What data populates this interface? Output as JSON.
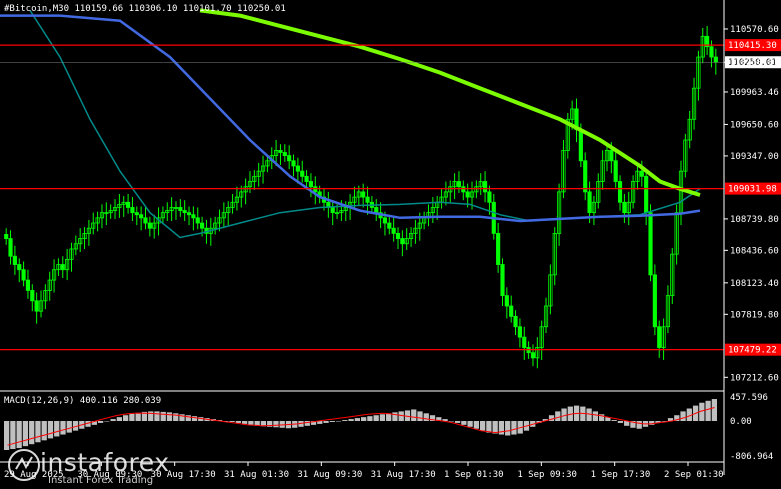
{
  "header": {
    "symbol": "#Bitcoin,M30",
    "ohlc": "110159.66 110306.10 110101.70 110250.01"
  },
  "price_axis": {
    "labels": [
      "110570.60",
      "110250.01",
      "109963.46",
      "109650.60",
      "109347.00",
      "108739.80",
      "108436.60",
      "108123.40",
      "107819.80",
      "107212.60"
    ],
    "highlighted": [
      {
        "label": "110415.30",
        "value": 110415.3,
        "color": "#ff0000"
      },
      {
        "label": "109031.98",
        "value": 109031.98,
        "color": "#ff0000"
      },
      {
        "label": "107479.22",
        "value": 107479.22,
        "color": "#ff0000"
      }
    ],
    "current": {
      "label": "110250.01",
      "value": 110250.01
    }
  },
  "time_axis": {
    "labels": [
      "29 Aug 2025",
      "30 Aug 09:30",
      "30 Aug 17:30",
      "31 Aug 01:30",
      "31 Aug 09:30",
      "31 Aug 17:30",
      "1 Sep 01:30",
      "1 Sep 09:30",
      "1 Sep 17:30",
      "2 Sep 01:30"
    ]
  },
  "macd": {
    "label": "MACD(12,26,9) 400.116 280.039",
    "axis_labels": [
      "457.596",
      "0.00",
      "-806.964"
    ]
  },
  "watermark": {
    "brand": "instaforex",
    "tagline": "Instant Forex Trading"
  },
  "colors": {
    "candle": "#00ff00",
    "ma_fast": "#4169e1",
    "ma_slow": "#7cfc00",
    "ma_teal": "#008b8b",
    "level": "#ff0000",
    "macd_hist": "#c0c0c0",
    "macd_signal": "#ff0000"
  },
  "chart_data": {
    "type": "candlestick",
    "ylim": [
      107100,
      110850
    ],
    "candles_close": [
      108550,
      108380,
      108300,
      108250,
      108150,
      108050,
      107950,
      107850,
      107950,
      108050,
      108150,
      108250,
      108300,
      108250,
      108350,
      108450,
      108500,
      108550,
      108600,
      108650,
      108700,
      108750,
      108800,
      108800,
      108820,
      108850,
      108880,
      108900,
      108850,
      108800,
      108780,
      108750,
      108700,
      108650,
      108700,
      108750,
      108800,
      108820,
      108850,
      108850,
      108820,
      108800,
      108780,
      108750,
      108700,
      108650,
      108600,
      108650,
      108700,
      108750,
      108800,
      108850,
      108900,
      108950,
      109000,
      109050,
      109100,
      109150,
      109200,
      109250,
      109300,
      109350,
      109400,
      109380,
      109350,
      109300,
      109250,
      109200,
      109150,
      109100,
      109050,
      109000,
      108950,
      108900,
      108850,
      108800,
      108800,
      108820,
      108850,
      108900,
      108950,
      109000,
      108950,
      108900,
      108850,
      108800,
      108750,
      108700,
      108650,
      108600,
      108550,
      108500,
      108550,
      108600,
      108650,
      108700,
      108750,
      108800,
      108850,
      108900,
      108950,
      109000,
      109050,
      109100,
      109050,
      109000,
      108950,
      109000,
      109050,
      109100,
      109000,
      108900,
      108600,
      108300,
      108000,
      107900,
      107800,
      107700,
      107600,
      107500,
      107450,
      107400,
      107500,
      107700,
      107900,
      108200,
      108600,
      109000,
      109400,
      109700,
      109800,
      109600,
      109300,
      109000,
      108800,
      108900,
      109100,
      109300,
      109400,
      109300,
      109100,
      108900,
      108800,
      108900,
      109100,
      109200,
      109150,
      108800,
      108200,
      107700,
      107500,
      107700,
      108000,
      108400,
      108800,
      109200,
      109500,
      109700,
      110000,
      110300,
      110500,
      110400,
      110300,
      110250
    ],
    "ma_fast": [
      [
        0,
        110700
      ],
      [
        60,
        110700
      ],
      [
        120,
        110650
      ],
      [
        170,
        110300
      ],
      [
        210,
        109900
      ],
      [
        250,
        109500
      ],
      [
        290,
        109150
      ],
      [
        320,
        108950
      ],
      [
        360,
        108820
      ],
      [
        400,
        108750
      ],
      [
        440,
        108760
      ],
      [
        480,
        108760
      ],
      [
        520,
        108720
      ],
      [
        560,
        108740
      ],
      [
        600,
        108760
      ],
      [
        640,
        108770
      ],
      [
        680,
        108790
      ],
      [
        700,
        108820
      ]
    ],
    "ma_slow": [
      [
        200,
        110750
      ],
      [
        240,
        110700
      ],
      [
        280,
        110600
      ],
      [
        320,
        110500
      ],
      [
        360,
        110400
      ],
      [
        400,
        110280
      ],
      [
        440,
        110150
      ],
      [
        480,
        110000
      ],
      [
        520,
        109850
      ],
      [
        560,
        109700
      ],
      [
        600,
        109500
      ],
      [
        640,
        109250
      ],
      [
        660,
        109100
      ],
      [
        680,
        109030
      ],
      [
        700,
        108970
      ]
    ],
    "ma_teal": [
      [
        30,
        110750
      ],
      [
        60,
        110300
      ],
      [
        90,
        109700
      ],
      [
        120,
        109200
      ],
      [
        150,
        108800
      ],
      [
        180,
        108560
      ],
      [
        200,
        108600
      ],
      [
        240,
        108700
      ],
      [
        280,
        108800
      ],
      [
        320,
        108850
      ],
      [
        360,
        108870
      ],
      [
        400,
        108880
      ],
      [
        440,
        108900
      ],
      [
        470,
        108880
      ],
      [
        500,
        108780
      ],
      [
        530,
        108720
      ],
      [
        560,
        108740
      ],
      [
        600,
        108760
      ],
      [
        640,
        108780
      ],
      [
        680,
        108900
      ],
      [
        700,
        109030
      ]
    ],
    "macd_hist": [
      -600,
      -580,
      -560,
      -520,
      -480,
      -440,
      -400,
      -360,
      -320,
      -280,
      -240,
      -200,
      -160,
      -120,
      -80,
      -40,
      0,
      40,
      80,
      120,
      150,
      170,
      190,
      200,
      200,
      190,
      180,
      160,
      140,
      120,
      100,
      80,
      60,
      40,
      20,
      0,
      -20,
      -40,
      -60,
      -80,
      -100,
      -110,
      -120,
      -130,
      -140,
      -150,
      -140,
      -120,
      -100,
      -80,
      -60,
      -40,
      -20,
      0,
      20,
      40,
      60,
      80,
      100,
      120,
      140,
      160,
      180,
      200,
      220,
      240,
      200,
      160,
      120,
      80,
      40,
      0,
      -40,
      -80,
      -120,
      -160,
      -200,
      -240,
      -260,
      -280,
      -300,
      -280,
      -260,
      -200,
      -120,
      -40,
      40,
      120,
      200,
      260,
      300,
      320,
      300,
      260,
      200,
      140,
      80,
      20,
      -40,
      -100,
      -140,
      -160,
      -120,
      -80,
      -40,
      0,
      60,
      120,
      200,
      260,
      320,
      380,
      420,
      457
    ],
    "macd_signal": [
      -500,
      -460,
      -420,
      -380,
      -340,
      -300,
      -260,
      -220,
      -180,
      -140,
      -100,
      -60,
      -20,
      20,
      60,
      100,
      130,
      150,
      160,
      165,
      160,
      150,
      140,
      130,
      120,
      100,
      80,
      60,
      40,
      20,
      0,
      -20,
      -40,
      -60,
      -80,
      -90,
      -100,
      -95,
      -90,
      -80,
      -70,
      -60,
      -40,
      -20,
      0,
      20,
      40,
      60,
      80,
      100,
      120,
      140,
      150,
      160,
      150,
      130,
      110,
      90,
      70,
      50,
      30,
      10,
      -10,
      -40,
      -80,
      -120,
      -160,
      -200,
      -220,
      -240,
      -220,
      -200,
      -160,
      -120,
      -80,
      -40,
      0,
      40,
      80,
      120,
      150,
      160,
      150,
      130,
      110,
      80,
      50,
      20,
      -10,
      -40,
      -60,
      -60,
      -40,
      -20,
      0,
      40,
      80,
      140,
      200,
      240,
      280
    ]
  }
}
